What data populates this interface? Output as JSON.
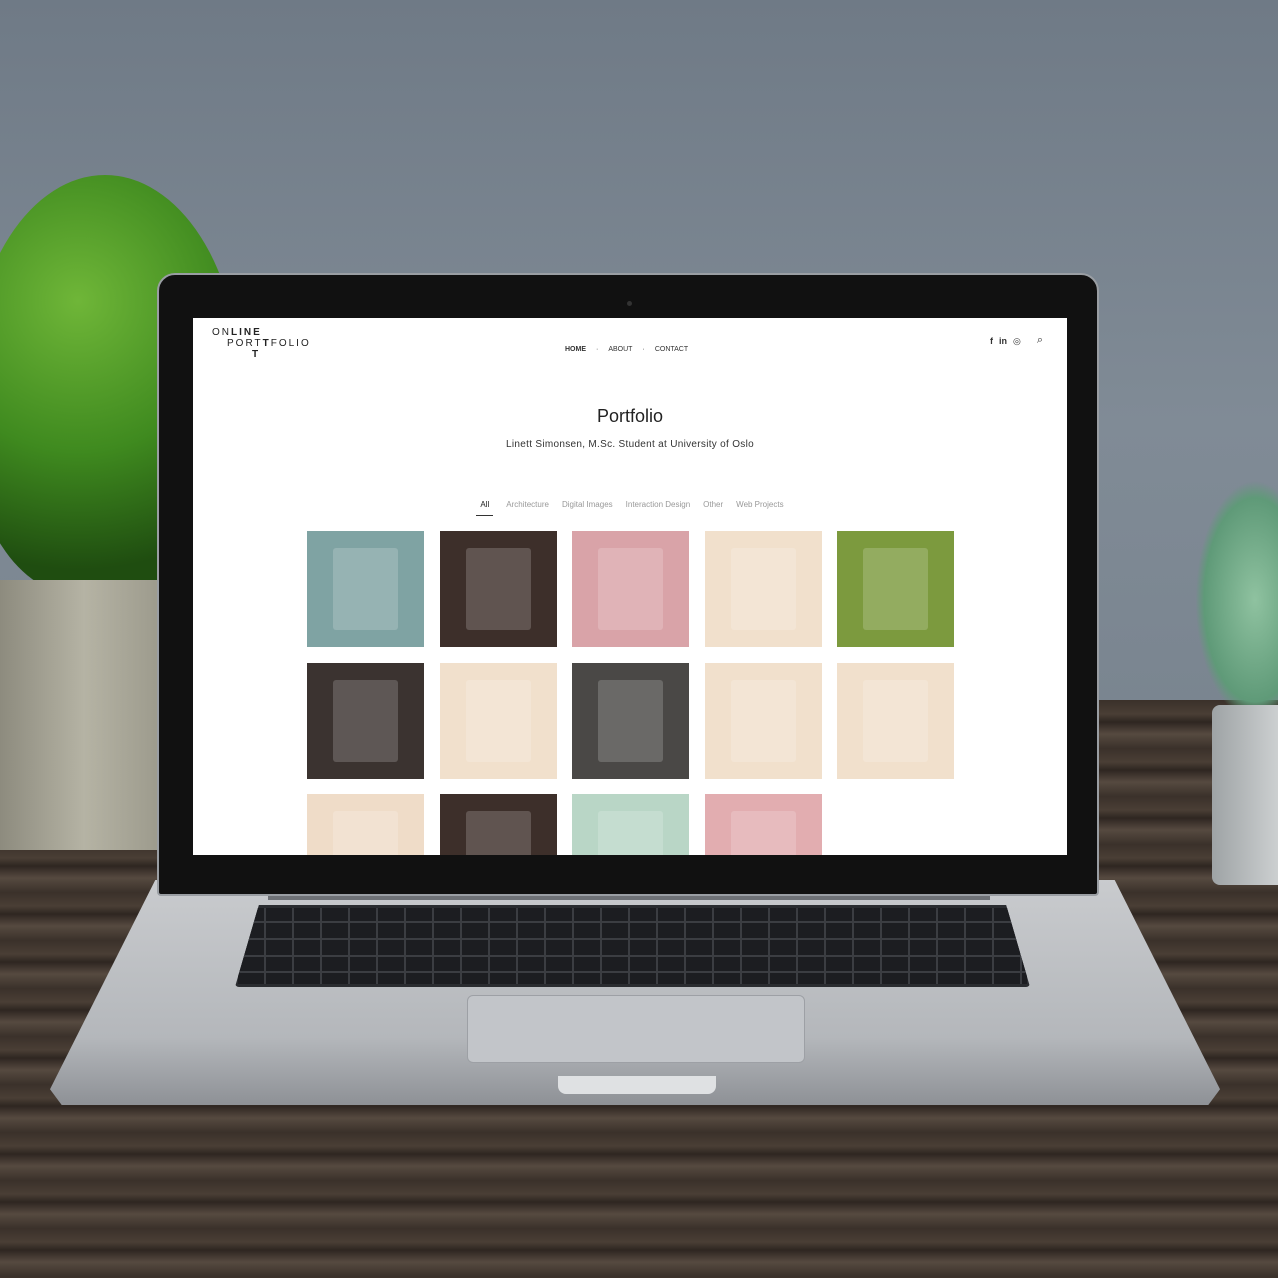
{
  "site": {
    "logo": {
      "line1_light": "ON",
      "line1_bold": "LINE",
      "line2_a": "PORT",
      "line2_b": "T",
      "line2_c": "FOLIO",
      "line3": "T"
    },
    "nav": [
      {
        "label": "HOME",
        "active": true
      },
      {
        "label": "ABOUT"
      },
      {
        "label": "CONTACT"
      }
    ],
    "nav_separator": "·",
    "social_icons": [
      "facebook-icon",
      "linkedin-icon",
      "instagram-icon",
      "search-icon"
    ],
    "social_glyphs": {
      "facebook": "f",
      "linkedin": "in",
      "instagram": "◎",
      "search": "⌕"
    },
    "title": "Portfolio",
    "subtitle": "Linett Simonsen, M.Sc. Student at University of Oslo",
    "filters": [
      "All",
      "Architecture",
      "Digital Images",
      "Interaction Design",
      "Other",
      "Web Projects"
    ],
    "active_filter": "All",
    "thumbnails": [
      {
        "name": "architecture-model",
        "color": "#7fa3a3"
      },
      {
        "name": "phone-chat-app",
        "color": "#3d2f2a"
      },
      {
        "name": "pink-pattern",
        "color": "#d9a3a8"
      },
      {
        "name": "poster-game",
        "color": "#f1e0cc"
      },
      {
        "name": "aerial-triangles",
        "color": "#7c9a3e"
      },
      {
        "name": "phone-messages",
        "color": "#3b3330"
      },
      {
        "name": "photo-collage",
        "color": "#f1e0cc"
      },
      {
        "name": "laptop-website",
        "color": "#4a4846"
      },
      {
        "name": "charger-sketch",
        "color": "#f1e0cc"
      },
      {
        "name": "lightbulb-poster",
        "color": "#f1e0cc"
      },
      {
        "name": "maze",
        "color": "#efdcc8"
      },
      {
        "name": "phone-app",
        "color": "#3d2f2a"
      },
      {
        "name": "aurora",
        "color": "#b9d6c6"
      },
      {
        "name": "pink-crystal",
        "color": "#e2adb0"
      }
    ]
  }
}
